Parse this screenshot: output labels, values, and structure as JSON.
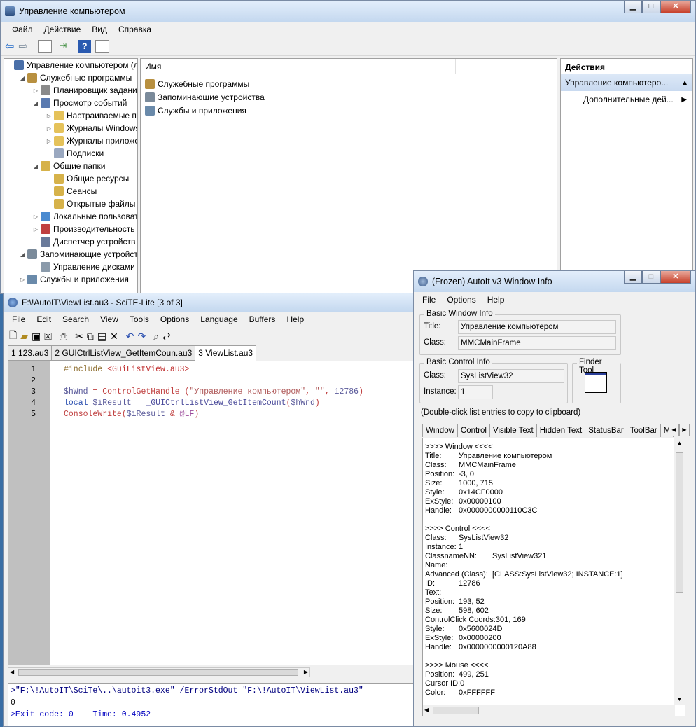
{
  "mmc": {
    "title": "Управление компьютером",
    "menu": [
      "Файл",
      "Действие",
      "Вид",
      "Справка"
    ],
    "tree": [
      {
        "label": "Управление компьютером (л",
        "level": 0,
        "arrow": "",
        "icon": "computer-icon"
      },
      {
        "label": "Служебные программы",
        "level": 1,
        "arrow": "◢",
        "icon": "tools-icon"
      },
      {
        "label": "Планировщик заданий",
        "level": 2,
        "arrow": "▷",
        "icon": "clock-icon"
      },
      {
        "label": "Просмотр событий",
        "level": 2,
        "arrow": "◢",
        "icon": "event-viewer-icon"
      },
      {
        "label": "Настраиваемые пр",
        "level": 3,
        "arrow": "▷",
        "icon": "folder-icon"
      },
      {
        "label": "Журналы Windows",
        "level": 3,
        "arrow": "▷",
        "icon": "folder-icon"
      },
      {
        "label": "Журналы приложе",
        "level": 3,
        "arrow": "▷",
        "icon": "folder-icon"
      },
      {
        "label": "Подписки",
        "level": 3,
        "arrow": "",
        "icon": "subscriptions-icon"
      },
      {
        "label": "Общие папки",
        "level": 2,
        "arrow": "◢",
        "icon": "shared-folder-icon"
      },
      {
        "label": "Общие ресурсы",
        "level": 3,
        "arrow": "",
        "icon": "shared-folder-icon"
      },
      {
        "label": "Сеансы",
        "level": 3,
        "arrow": "",
        "icon": "shared-folder-icon"
      },
      {
        "label": "Открытые файлы",
        "level": 3,
        "arrow": "",
        "icon": "shared-folder-icon"
      },
      {
        "label": "Локальные пользовате",
        "level": 2,
        "arrow": "▷",
        "icon": "users-icon"
      },
      {
        "label": "Производительность",
        "level": 2,
        "arrow": "▷",
        "icon": "performance-icon"
      },
      {
        "label": "Диспетчер устройств",
        "level": 2,
        "arrow": "",
        "icon": "device-manager-icon"
      },
      {
        "label": "Запоминающие устройст",
        "level": 1,
        "arrow": "◢",
        "icon": "storage-icon"
      },
      {
        "label": "Управление дисками",
        "level": 2,
        "arrow": "",
        "icon": "disk-icon"
      },
      {
        "label": "Службы и приложения",
        "level": 1,
        "arrow": "▷",
        "icon": "services-icon"
      }
    ],
    "list_header": "Имя",
    "list_items": [
      {
        "label": "Служебные программы",
        "icon": "tools-icon"
      },
      {
        "label": "Запоминающие устройства",
        "icon": "storage-icon"
      },
      {
        "label": "Службы и приложения",
        "icon": "services-icon"
      }
    ],
    "actions": {
      "header": "Действия",
      "section": "Управление компьютеро...",
      "item": "Дополнительные дей..."
    }
  },
  "scite": {
    "title": "F:\\!AutoIT\\ViewList.au3 - SciTE-Lite [3 of 3]",
    "menu": [
      "File",
      "Edit",
      "Search",
      "View",
      "Tools",
      "Options",
      "Language",
      "Buffers",
      "Help"
    ],
    "tabs": [
      "1 123.au3",
      "2 GUICtrlListView_GetItemCoun.au3",
      "3 ViewList.au3"
    ],
    "active_tab": 2,
    "line_numbers": [
      "1",
      "2",
      "3",
      "4",
      "5"
    ],
    "code": [
      [
        {
          "t": "#include ",
          "c": "#8b6b2b"
        },
        {
          "t": "<GuiListView.au3>",
          "c": "#c03030"
        }
      ],
      [],
      [
        {
          "t": "$hWnd",
          "c": "#5a5a9a"
        },
        {
          "t": " = ",
          "c": "#c04040"
        },
        {
          "t": "ControlGetHandle",
          "c": "#c04040"
        },
        {
          "t": " (",
          "c": "#c04040"
        },
        {
          "t": "\"Управление компьютером\"",
          "c": "#b05a5a"
        },
        {
          "t": ", ",
          "c": "#c04040"
        },
        {
          "t": "\"\"",
          "c": "#b05a5a"
        },
        {
          "t": ", ",
          "c": "#c04040"
        },
        {
          "t": "12786",
          "c": "#5a5a9a"
        },
        {
          "t": ")",
          "c": "#c04040"
        }
      ],
      [
        {
          "t": "local",
          "c": "#2a4fb0"
        },
        {
          "t": " ",
          "c": "#000"
        },
        {
          "t": "$iResult",
          "c": "#5a5a9a"
        },
        {
          "t": " = ",
          "c": "#c04040"
        },
        {
          "t": "_GUICtrlListView_GetItemCount",
          "c": "#4a4a9a"
        },
        {
          "t": "(",
          "c": "#c04040"
        },
        {
          "t": "$hWnd",
          "c": "#5a5a9a"
        },
        {
          "t": ")",
          "c": "#c04040"
        }
      ],
      [
        {
          "t": "ConsoleWrite",
          "c": "#c04040"
        },
        {
          "t": "(",
          "c": "#c04040"
        },
        {
          "t": "$iResult",
          "c": "#5a5a9a"
        },
        {
          "t": " & ",
          "c": "#c04040"
        },
        {
          "t": "@LF",
          "c": "#9a4a9a"
        },
        {
          "t": ")",
          "c": "#c04040"
        }
      ]
    ],
    "output": [
      {
        "t": ">\"F:\\!AutoIT\\SciTe\\..\\autoit3.exe\" /ErrorStdOut \"F:\\!AutoIT\\ViewList.au3\"",
        "c": "#00007f"
      },
      {
        "t": "0",
        "c": "#000000"
      },
      {
        "t": ">Exit code: 0    Time: 0.4952",
        "c": "#0000c0"
      }
    ]
  },
  "autoit": {
    "title": "(Frozen) AutoIt v3 Window Info",
    "menu": [
      "File",
      "Options",
      "Help"
    ],
    "basic_window": {
      "group": "Basic Window Info",
      "title_label": "Title:",
      "title_value": "Управление компьютером",
      "class_label": "Class:",
      "class_value": "MMCMainFrame"
    },
    "basic_control": {
      "group": "Basic Control Info",
      "class_label": "Class:",
      "class_value": "SysListView32",
      "instance_label": "Instance:",
      "instance_value": "1"
    },
    "finder_tool": "Finder Tool",
    "hint": "(Double-click list entries to copy to clipboard)",
    "tabs": [
      "Window",
      "Control",
      "Visible Text",
      "Hidden Text",
      "StatusBar",
      "ToolBar",
      "M"
    ],
    "info": [
      {
        "k": ">>>> Window <<<<",
        "v": "",
        "w": 0
      },
      {
        "k": "Title:",
        "v": "Управление компьютером",
        "w": 48
      },
      {
        "k": "Class:",
        "v": "MMCMainFrame",
        "w": 48
      },
      {
        "k": "Position:",
        "v": "-3, 0",
        "w": 48
      },
      {
        "k": "Size:",
        "v": "1000, 715",
        "w": 48
      },
      {
        "k": "Style:",
        "v": "0x14CF0000",
        "w": 48
      },
      {
        "k": "ExStyle:",
        "v": "0x00000100",
        "w": 48
      },
      {
        "k": "Handle:",
        "v": "0x0000000000110C3C",
        "w": 48
      },
      {
        "k": "",
        "v": "",
        "w": 0
      },
      {
        "k": ">>>> Control <<<<",
        "v": "",
        "w": 0
      },
      {
        "k": "Class:",
        "v": "SysListView32",
        "w": 48
      },
      {
        "k": "Instance:",
        "v": "1",
        "w": 48
      },
      {
        "k": "ClassnameNN:",
        "v": "SysListView321",
        "w": 96
      },
      {
        "k": "Name:",
        "v": "",
        "w": 48
      },
      {
        "k": "Advanced (Class):",
        "v": "[CLASS:SysListView32; INSTANCE:1]",
        "w": 96
      },
      {
        "k": "ID:",
        "v": "12786",
        "w": 48
      },
      {
        "k": "Text:",
        "v": "",
        "w": 48
      },
      {
        "k": "Position:",
        "v": "193, 52",
        "w": 48
      },
      {
        "k": "Size:",
        "v": "598, 602",
        "w": 48
      },
      {
        "k": "ControlClick Coords:",
        "v": "301, 169",
        "w": 0
      },
      {
        "k": "Style:",
        "v": "0x5600024D",
        "w": 48
      },
      {
        "k": "ExStyle:",
        "v": "0x00000200",
        "w": 48
      },
      {
        "k": "Handle:",
        "v": "0x0000000000120A88",
        "w": 48
      },
      {
        "k": "",
        "v": "",
        "w": 0
      },
      {
        "k": ">>>> Mouse <<<<",
        "v": "",
        "w": 0
      },
      {
        "k": "Position:",
        "v": "499, 251",
        "w": 48
      },
      {
        "k": "Cursor ID:",
        "v": "0",
        "w": 0
      },
      {
        "k": "Color:",
        "v": "0xFFFFFF",
        "w": 48
      }
    ]
  }
}
